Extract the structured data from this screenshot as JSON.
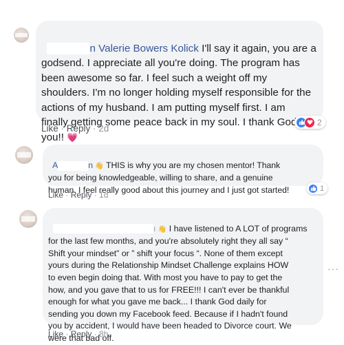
{
  "comments": [
    {
      "author_visible": "n Valerie Bowers Kolick",
      "lines": [
        " I'll say it again, you are a",
        "godsend. I appreciate all you're doing. The program has",
        "been awesome so far. I feel such a weight off my",
        "shoulders. I'm no longer holding myself responsible for the",
        "actions of my husband. I am putting myself first. I am",
        "finally getting some peace back in my soul. I thank God for",
        "you!! "
      ],
      "heart_emoji": "💗",
      "actions": {
        "like": "Like",
        "reply": "Reply",
        "time": "2d"
      },
      "reaction_icons": [
        "thumbs-up-icon",
        "heart-icon"
      ],
      "reaction_count": "2"
    },
    {
      "author_visible_a": "A",
      "author_visible_b": "n",
      "wave_emoji": "👋",
      "lines": [
        " THIS is why you are my chosen mentor! Thank",
        "you for being knowledgeable, willing to share, and a genuine",
        "human. I feel really good about this journey and I just got started!"
      ],
      "actions": {
        "like": "Like",
        "reply": "Reply",
        "time": "1d"
      },
      "reaction_icons": [
        "thumbs-up-icon"
      ],
      "reaction_count": "1"
    },
    {
      "author_visible": "ı",
      "wave_emoji": "👋",
      "lines": [
        " I have listened to A LOT of programs",
        "for the last few months, and you're absolutely right they all say “",
        "Shift your mindset” or ” shift your focus “. None of them except",
        "yours during the Relationship Mindset Challenge explains HOW",
        "to even begin doing that. With most you have to pay to get the",
        "how, and you gave that to us for FREE!!! I can't ever be thankful",
        "enough for what you gave me back... I thank God daily for",
        "sending you down my Facebook feed. Because if I hadn't found",
        "you by accident, I would have been headed to Divorce court. We",
        "were that bad off."
      ],
      "actions": {
        "like": "Like",
        "reply": "Reply",
        "time": "8h"
      },
      "more_icon": "more-options-icon"
    }
  ],
  "colors": {
    "bubble": "#f2f3f5",
    "name": "#385898",
    "action_link": "#4b4f56",
    "meta": "#90949c",
    "like_blue": "#3b82f6",
    "love_red": "#f0284a"
  },
  "separator": " · "
}
